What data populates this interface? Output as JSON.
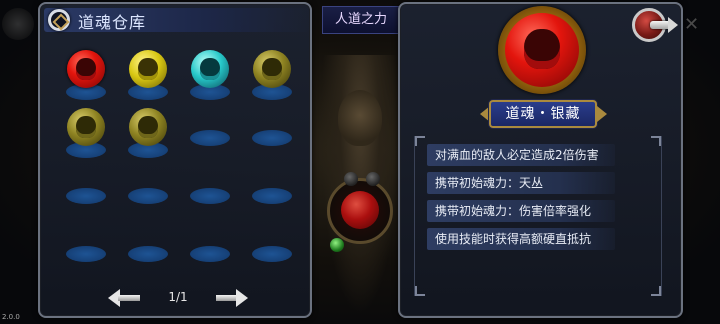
{
  "storage_panel": {
    "title": "道魂仓库",
    "pager": {
      "page_text": "1/1"
    },
    "slots": [
      {
        "icon": "soul-orb-red-icon",
        "color": "red",
        "filled": true
      },
      {
        "icon": "soul-orb-yellow-icon",
        "color": "yellow",
        "filled": true
      },
      {
        "icon": "soul-orb-cyan-icon",
        "color": "cyan",
        "filled": true
      },
      {
        "icon": "soul-orb-olive-icon",
        "color": "olive",
        "filled": true
      },
      {
        "icon": "soul-orb-olive-icon",
        "color": "olive",
        "filled": true
      },
      {
        "icon": "soul-orb-olive-icon",
        "color": "olive",
        "filled": true
      },
      {
        "filled": false
      },
      {
        "filled": false
      },
      {
        "filled": false
      },
      {
        "filled": false
      },
      {
        "filled": false
      },
      {
        "filled": false
      },
      {
        "filled": false
      },
      {
        "filled": false
      },
      {
        "filled": false
      },
      {
        "filled": false
      }
    ]
  },
  "detail_panel": {
    "name": "道魂・银藏",
    "icon": "soul-orb-red-icon",
    "descriptions": [
      "对满血的敌人必定造成2倍伤害",
      "携带初始魂力：天丛",
      "携带初始魂力：伤害倍率强化",
      "使用技能时获得高额硬直抵抗"
    ]
  },
  "background": {
    "tab_label": "人道之力",
    "version": "2.0.0"
  },
  "colors": {
    "panel_border": "#6b7280",
    "empty_slot": "#1f5aa0",
    "name_plate": "#2a3d8c",
    "accent_gold": "#aa8a3e"
  }
}
